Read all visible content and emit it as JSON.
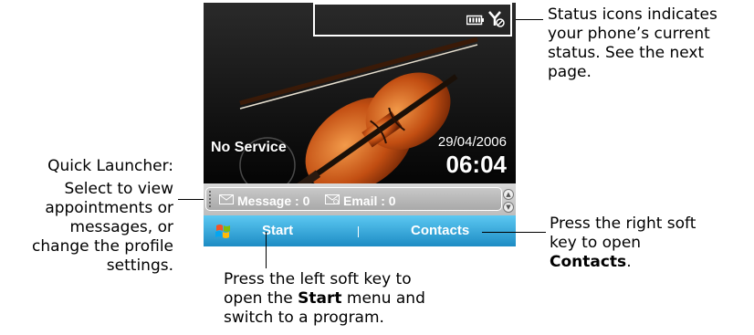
{
  "callouts": {
    "status": {
      "line1": "Status icons indicates",
      "line2": "your phone’s current",
      "line3": "status. See the next",
      "line4": "page."
    },
    "quick_launcher": {
      "title": "Quick Launcher:",
      "line1": "Select to view",
      "line2": "appointments or",
      "line3": "messages, or",
      "line4": "change the profile",
      "line5": "settings."
    },
    "right_softkey": {
      "line1": "Press the right soft",
      "line2": "key to open",
      "line3": "Contacts",
      "line3_suffix": "."
    },
    "left_softkey": {
      "line1": "Press the left soft key to",
      "line2_prefix": "open the ",
      "line2_bold": "Start",
      "line2_suffix": " menu and",
      "line3": "switch to a program."
    }
  },
  "phone": {
    "network_status": "No Service",
    "date": "29/04/2006",
    "time": "06:04",
    "quick_launcher": {
      "message": "Message : 0",
      "email": "Email : 0"
    },
    "softkeys": {
      "left": "Start",
      "right": "Contacts"
    }
  },
  "colors": {
    "softkey_bar": "#2aa7de",
    "quick_launcher_bg": "#c4c4c4"
  }
}
